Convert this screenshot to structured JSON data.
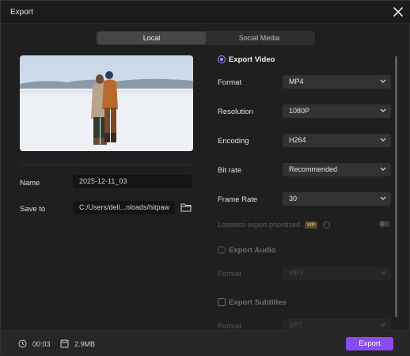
{
  "window": {
    "title": "Export"
  },
  "tabs": [
    {
      "label": "Local",
      "active": true
    },
    {
      "label": "Social Media",
      "active": false
    }
  ],
  "left": {
    "name_label": "Name",
    "name_value": "2025-12-11_03",
    "saveto_label": "Save to",
    "saveto_value": "C:/Users/dell...nloads/hitpaw"
  },
  "video": {
    "heading": "Export Video",
    "rows": [
      {
        "label": "Format",
        "value": "MP4"
      },
      {
        "label": "Resolution",
        "value": "1080P"
      },
      {
        "label": "Encoding",
        "value": "H264"
      },
      {
        "label": "Bit rate",
        "value": "Recommended"
      },
      {
        "label": "Frame Rate",
        "value": "30"
      }
    ],
    "lossless_label": "Lossless export prioritized",
    "vip_badge": "VIP",
    "info_glyph": "i"
  },
  "audio": {
    "heading": "Export Audio",
    "format_label": "Format",
    "format_value": "MP3"
  },
  "subtitles": {
    "heading": "Export Subtitles",
    "format_label": "Format",
    "format_value": "SRT"
  },
  "footer": {
    "duration": "00:03",
    "size": "2.9MB",
    "export_label": "Export"
  },
  "colors": {
    "accent": "#8a4cf0",
    "radio": "#b58cff",
    "background": "#1f1f1f"
  },
  "icons": [
    "close-icon",
    "folder-icon",
    "chevron-down-icon",
    "clock-icon",
    "file-size-icon",
    "info-icon"
  ]
}
